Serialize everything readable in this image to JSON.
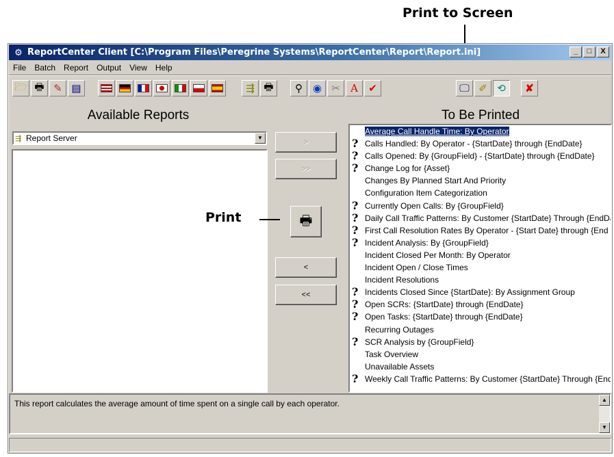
{
  "annotations": {
    "print_to_screen": "Print to Screen",
    "print": "Print"
  },
  "window": {
    "title": "ReportCenter Client [C:\\Program Files\\Peregrine Systems\\ReportCenter\\Report\\Report.ini]",
    "minimize": "_",
    "maximize": "□",
    "close": "X"
  },
  "menu": [
    "File",
    "Batch",
    "Report",
    "Output",
    "View",
    "Help"
  ],
  "toolbar": {
    "icons": [
      "open-folder-icon",
      "print-icon",
      "tools-icon",
      "properties-icon",
      "flag-us-icon",
      "flag-germany-icon",
      "flag-france-icon",
      "flag-japan-icon",
      "flag-italy-icon",
      "flag-poland-icon",
      "flag-spain-icon",
      "server-icon",
      "lock-print-icon",
      "binoculars-icon",
      "eye-icon",
      "scissors-icon",
      "font-icon",
      "checkmark-icon",
      "print-to-screen-icon",
      "edit-icon",
      "refresh-icon",
      "cancel-icon"
    ]
  },
  "left_panel": {
    "title": "Available Reports",
    "combo_value": "Report Server"
  },
  "middle": {
    "add": ">",
    "add_all": ">>",
    "remove": "<",
    "remove_all": "<<"
  },
  "right_panel": {
    "title": "To Be Printed",
    "items": [
      {
        "label": "Average Call Handle Time: By Operator",
        "q": false,
        "selected": true
      },
      {
        "label": "Calls Handled: By Operator - {StartDate} through {EndDate}",
        "q": true
      },
      {
        "label": "Calls Opened: By {GroupField} - {StartDate} through {EndDate}",
        "q": true
      },
      {
        "label": "Change Log for {Asset}",
        "q": true
      },
      {
        "label": "Changes By Planned Start And Priority",
        "q": false
      },
      {
        "label": "Configuration Item Categorization",
        "q": false
      },
      {
        "label": "Currently Open Calls: By {GroupField}",
        "q": true
      },
      {
        "label": "Daily Call Traffic Patterns: By Customer {StartDate} Through {EndDate}",
        "q": true
      },
      {
        "label": "First Call Resolution Rates By Operator - {Start Date} through {End Date}",
        "q": true
      },
      {
        "label": "Incident Analysis: By {GroupField}",
        "q": true
      },
      {
        "label": "Incident Closed Per Month: By Operator",
        "q": false
      },
      {
        "label": "Incident Open / Close Times",
        "q": false
      },
      {
        "label": "Incident Resolutions",
        "q": false
      },
      {
        "label": "Incidents Closed Since {StartDate}: By Assignment Group",
        "q": true
      },
      {
        "label": "Open SCRs: {StartDate} through {EndDate}",
        "q": true
      },
      {
        "label": "Open Tasks: {StartDate} through {EndDate}",
        "q": true
      },
      {
        "label": "Recurring Outages",
        "q": false
      },
      {
        "label": "SCR Analysis by {GroupField}",
        "q": true
      },
      {
        "label": "Task Overview",
        "q": false
      },
      {
        "label": "Unavailable Assets",
        "q": false
      },
      {
        "label": "Weekly Call Traffic Patterns: By Customer {StartDate} Through {EndDate}",
        "q": true
      }
    ]
  },
  "description": "This report calculates the average amount of time spent on a single call by each operator.",
  "colors": {
    "selection": "#0a246a",
    "titlebar": "#0a246a",
    "face": "#d4d0c8"
  }
}
